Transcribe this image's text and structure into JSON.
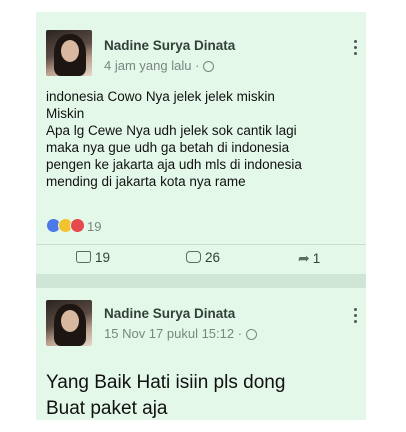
{
  "post1": {
    "author": "Nadine Surya Dinata",
    "time": "4 jam yang lalu",
    "lines": [
      "indonesia Cowo Nya jelek jelek miskin",
      "Miskin",
      "Apa lg Cewe Nya udh jelek sok cantik lagi",
      "maka nya gue udh ga betah di indonesia",
      "pengen ke jakarta aja udh mls di indonesia",
      "mending di jakarta kota nya rame"
    ],
    "reaction_count": "19",
    "likes": "19",
    "comments": "26",
    "shares": "1"
  },
  "post2": {
    "author": "Nadine Surya Dinata",
    "time": "15 Nov 17 pukul 15:12",
    "lines": [
      "Yang Baik Hati isiin pls dong",
      "Buat paket aja"
    ]
  },
  "colors": {
    "card_bg": "#e3f8e9",
    "like_reaction": "#4c78e8",
    "haha_reaction": "#f2c230",
    "love_reaction": "#e5484d"
  },
  "icons": [
    "globe-icon",
    "more-options-icon",
    "like-icon",
    "comment-icon",
    "share-icon"
  ]
}
